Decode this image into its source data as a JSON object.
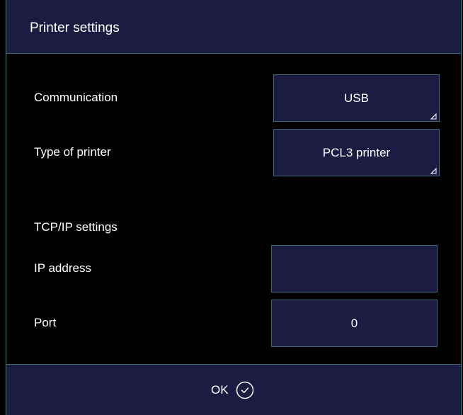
{
  "dialog": {
    "title": "Printer settings"
  },
  "settings": {
    "communication": {
      "label": "Communication",
      "value": "USB",
      "icon": "dropdown-corner-icon"
    },
    "printer_type": {
      "label": "Type of printer",
      "value": "PCL3 printer",
      "icon": "dropdown-corner-icon"
    }
  },
  "tcpip": {
    "section_label": "TCP/IP settings",
    "ip_address": {
      "label": "IP address",
      "value": ""
    },
    "port": {
      "label": "Port",
      "value": "0"
    }
  },
  "footer": {
    "ok_label": "OK",
    "ok_icon": "check-circle-icon"
  },
  "colors": {
    "panel": "#1c1c42",
    "border": "#3a6a78",
    "background": "#000000",
    "text": "#ffffff"
  }
}
